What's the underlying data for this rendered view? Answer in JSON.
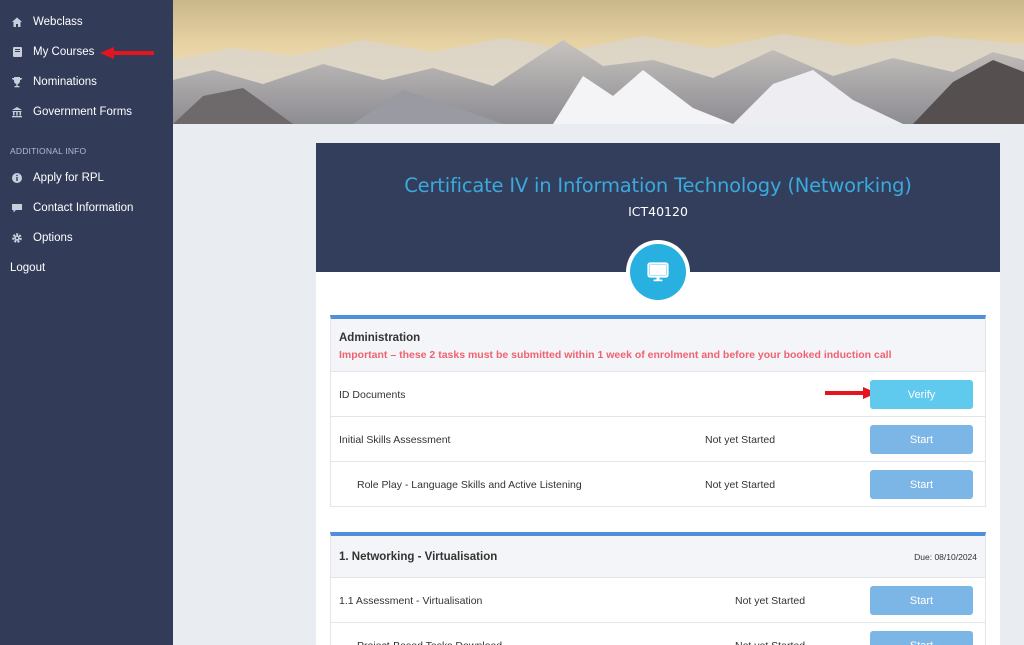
{
  "sidebar": {
    "items": [
      {
        "label": "Webclass",
        "icon": "home-icon"
      },
      {
        "label": "My Courses",
        "icon": "book-icon"
      },
      {
        "label": "Nominations",
        "icon": "trophy-icon"
      },
      {
        "label": "Government Forms",
        "icon": "bank-icon"
      }
    ],
    "section_label": "ADDITIONAL INFO",
    "extra_items": [
      {
        "label": "Apply for RPL",
        "icon": "info-icon"
      },
      {
        "label": "Contact Information",
        "icon": "chat-icon"
      },
      {
        "label": "Options",
        "icon": "gear-icon"
      }
    ],
    "logout_label": "Logout"
  },
  "course": {
    "title": "Certificate IV in Information Technology (Networking)",
    "code": "ICT40120",
    "icon": "monitor-icon"
  },
  "admin": {
    "title": "Administration",
    "important": "Important – these 2 tasks must be submitted within 1 week of enrolment and before your booked induction call",
    "rows": [
      {
        "name": "ID Documents",
        "status": "",
        "button": "Verify"
      },
      {
        "name": "Initial Skills Assessment",
        "status": "Not yet Started",
        "button": "Start"
      },
      {
        "name": "Role Play - Language Skills and Active Listening",
        "status": "Not yet Started",
        "button": "Start"
      }
    ]
  },
  "unit1": {
    "title": "1. Networking - Virtualisation",
    "due": "Due: 08/10/2024",
    "rows": [
      {
        "name": "1.1 Assessment - Virtualisation",
        "status": "Not yet Started",
        "button": "Start"
      },
      {
        "name": "Project-Based Tasks Download",
        "status": "Not yet Started",
        "button": "Start"
      }
    ]
  },
  "colors": {
    "sidebar": "#323b58",
    "course_header": "#333e5d",
    "title_blue": "#3aa9dc",
    "accent": "#4f8fdc",
    "important_red": "#f06270",
    "verify_btn": "#5fc9ee",
    "start_btn": "#7cb6e7",
    "annotation_arrow": "#e4151c"
  }
}
